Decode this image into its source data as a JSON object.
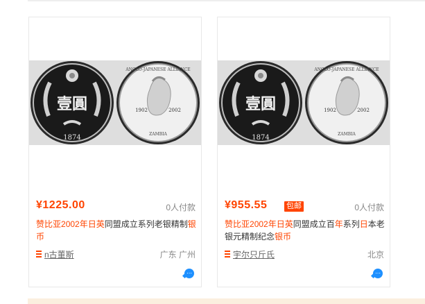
{
  "colors": {
    "accent": "#ff4400",
    "muted": "#888888",
    "chat": "#1e90ff",
    "coin_silver": "#c8c8c8"
  },
  "products": [
    {
      "price": "¥1225.00",
      "badge": "",
      "paid_count": "0人付款",
      "title_parts": [
        {
          "text": "赞比亚",
          "hl": true
        },
        {
          "text": "2002年",
          "hl": true
        },
        {
          "text": "日英",
          "hl": true
        },
        {
          "text": "同盟成立系列老银精制",
          "hl": false
        },
        {
          "text": "银币",
          "hl": true
        }
      ],
      "seller": "n古董斯",
      "location": "广东 广州",
      "coin_left": {
        "legend": "壹圓",
        "year": "1874"
      },
      "coin_right": {
        "legend": "ANGLO-JAPANESE ALLIANCE",
        "year_left": "1902",
        "year_right": "2002",
        "country": "ZAMBIA"
      },
      "icons": {
        "shop": "shop-icon",
        "chat": "chat-icon"
      }
    },
    {
      "price": "¥955.55",
      "badge": "包邮",
      "paid_count": "0人付款",
      "title_parts": [
        {
          "text": "赞比亚",
          "hl": true
        },
        {
          "text": "2002年",
          "hl": true
        },
        {
          "text": "日英",
          "hl": true
        },
        {
          "text": "同盟成立百",
          "hl": false
        },
        {
          "text": "年",
          "hl": true
        },
        {
          "text": "系列",
          "hl": false
        },
        {
          "text": "日",
          "hl": true
        },
        {
          "text": "本老银元精制纪念",
          "hl": false
        },
        {
          "text": "银币",
          "hl": true
        }
      ],
      "seller": "宇尔只斤氏",
      "location": "北京",
      "coin_left": {
        "legend": "壹圓",
        "year": "1874"
      },
      "coin_right": {
        "legend": "ANGLO-JAPANESE ALLIANCE",
        "year_left": "1902",
        "year_right": "2002",
        "country": "ZAMBIA"
      },
      "icons": {
        "shop": "shop-icon",
        "chat": "chat-icon"
      }
    }
  ]
}
